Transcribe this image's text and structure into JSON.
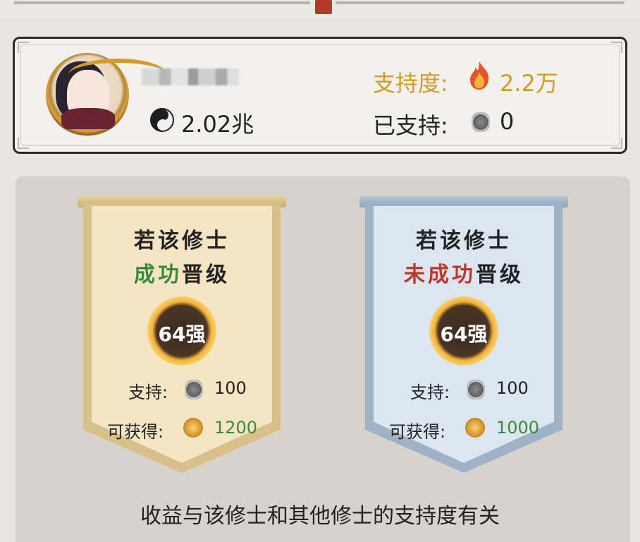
{
  "profile": {
    "power_value": "2.02兆",
    "support_label": "支持度:",
    "support_value": "2.2万",
    "supported_label": "已支持:",
    "supported_value": "0"
  },
  "options": [
    {
      "title_line1": "若该修士",
      "title_line2_a": "成功",
      "title_line2_b": "晋级",
      "rank": "64强",
      "support_label": "支持:",
      "support_value": "100",
      "reward_label": "可获得:",
      "reward_value": "1200"
    },
    {
      "title_line1": "若该修士",
      "title_line2_a": "未成功",
      "title_line2_b": "晋级",
      "rank": "64强",
      "support_label": "支持:",
      "support_value": "100",
      "reward_label": "可获得:",
      "reward_value": "1000"
    }
  ],
  "footer": {
    "note": "收益与该修士和其他修士的支持度有关"
  },
  "colors": {
    "support_gold": "#d49a2a",
    "success_green": "#3a8a3a",
    "fail_red": "#c0362c"
  },
  "icons": [
    "yin-yang-icon",
    "fire-icon",
    "support-token-icon",
    "reward-coin-icon",
    "red-seal-icon"
  ]
}
